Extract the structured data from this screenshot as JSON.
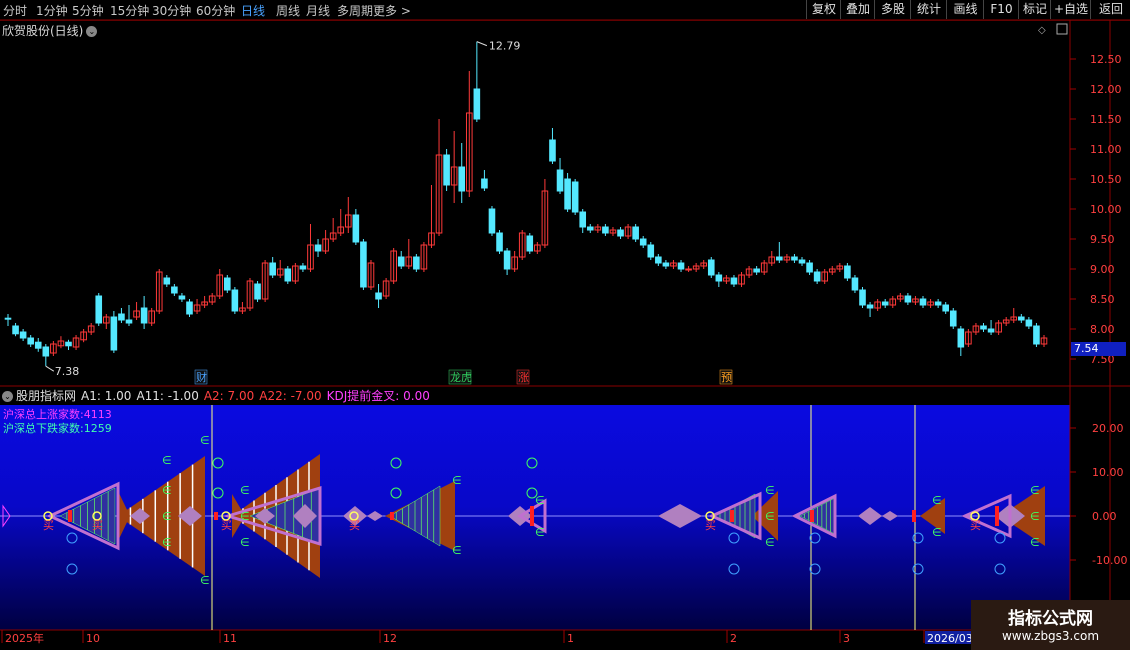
{
  "toolbar": {
    "periods": [
      "分时",
      "1分钟",
      "5分钟",
      "15分钟",
      "30分钟",
      "60分钟",
      "日线",
      "周线",
      "月线",
      "多周期",
      "更多 >"
    ],
    "active_period": "日线",
    "right_buttons": [
      "复权",
      "叠加",
      "多股",
      "统计",
      "画线",
      "F10",
      "标记",
      "+自选",
      "返回"
    ]
  },
  "stock_title": "欣贺股份(日线)",
  "price_axis": [
    "12.50",
    "12.00",
    "11.50",
    "11.00",
    "10.50",
    "10.00",
    "9.50",
    "9.00",
    "8.50",
    "8.00",
    "7.50"
  ],
  "high_label": "12.79",
  "low_label": "7.38",
  "current_price": "7.54",
  "markers": [
    "财",
    "龙虎",
    "涨",
    "预"
  ],
  "indicator": {
    "name": "股朋指标网",
    "params": [
      {
        "text": "A1: 1.00",
        "color": "#e0e0e0"
      },
      {
        "text": "A11: -1.00",
        "color": "#e0e0e0"
      },
      {
        "text": "A2: 7.00",
        "color": "#ff4040"
      },
      {
        "text": "A22: -7.00",
        "color": "#ff4040"
      },
      {
        "text": "KDJ提前金叉: 0.00",
        "color": "#ff40ff"
      }
    ],
    "stat_up": "沪深总上涨家数:4113",
    "stat_down": "沪深总下跌家数:1259",
    "axis": [
      "20.00",
      "10.00",
      "0.00",
      "-10.00"
    ],
    "buy_label": "买"
  },
  "date_axis": [
    "2025年",
    "10",
    "11",
    "12",
    "1",
    "2",
    "3",
    "2026/03"
  ],
  "watermark": {
    "line1": "指标公式网",
    "line2": "www.zbgs3.com"
  },
  "colors": {
    "up": "#ff3a3a",
    "down": "#54e8ff",
    "indicator_bg": "#0a0ad8",
    "accent": "#4aa3ff"
  }
}
